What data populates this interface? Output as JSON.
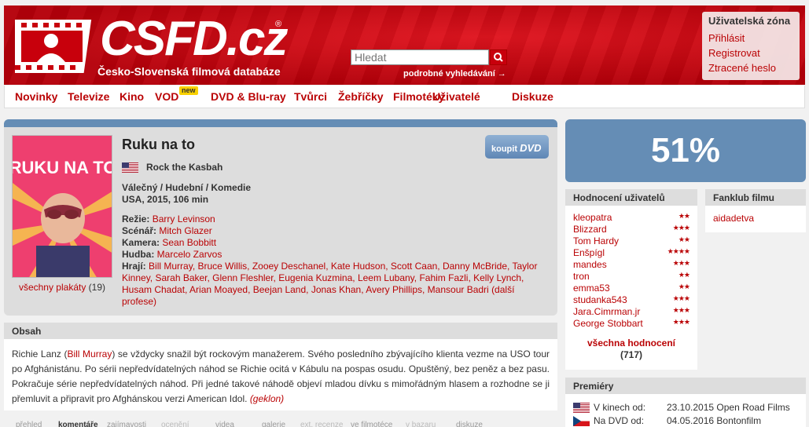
{
  "header": {
    "logo_text": "CSFD.cz",
    "logo_reg": "®",
    "tagline": "Česko-Slovenská filmová databáze",
    "search_placeholder": "Hledat",
    "advanced_search": "podrobné vyhledávání →"
  },
  "user_zone": {
    "title": "Uživatelská zóna",
    "login": "Přihlásit",
    "register": "Registrovat",
    "lost_password": "Ztracené heslo"
  },
  "nav": {
    "items": [
      "Novinky",
      "Televize",
      "Kino",
      "VOD",
      "DVD & Blu-ray",
      "Tvůrci",
      "Žebříčky",
      "Filmotéky",
      "Uživatelé",
      "Diskuze"
    ],
    "new_badge": "new"
  },
  "film": {
    "poster_title": "RUKU NA TO",
    "title": "Ruku na to",
    "original_title": "Rock the Kasbah",
    "genre": "Válečný / Hudební / Komedie",
    "origin": "USA, 2015, 106 min",
    "credits": {
      "director_label": "Režie:",
      "director": "Barry Levinson",
      "writer_label": "Scénář:",
      "writer": "Mitch Glazer",
      "camera_label": "Kamera:",
      "camera": "Sean Bobbitt",
      "music_label": "Hudba:",
      "music": "Marcelo Zarvos",
      "cast_label": "Hrají:",
      "cast": "Bill Murray, Bruce Willis, Zooey Deschanel, Kate Hudson, Scott Caan, Danny McBride, Taylor Kinney, Sarah Baker, Glenn Fleshler, Eugenia Kuzmina, Leem Lubany, Fahim Fazli, Kelly Lynch, Husam Chadat, Arian Moayed, Beejan Land, Jonas Khan, Avery Phillips, Mansour Badri",
      "more": "(další profese)"
    },
    "posters_link": "všechny plakáty",
    "posters_count": " (19)",
    "buy_label": "koupit",
    "buy_dvd": "DVD"
  },
  "obsah": {
    "title": "Obsah",
    "text_before": "Richie Lanz (",
    "actor": "Bill Murray",
    "text_after": ") se vždycky snažil být rockovým manažerem. Svého posledního zbývajícího klienta vezme na USO tour po Afghánistánu. Po sérii nepředvídatelných náhod se Richie ocitá v Kábulu na pospas osudu. Opuštěný, bez peněz a bez pasu. Pokračuje série nepředvídatelných náhod. Při jedné takové náhodě objeví mladou dívku s mimořádným hlasem a rozhodne se ji přemluvit a připravit pro Afghánskou verzi American Idol. ",
    "author": "(geklon)"
  },
  "tabs": [
    "přehled",
    "komentáře",
    "zajímavosti",
    "ocenění",
    "videa",
    "galerie",
    "ext. recenze",
    "ve filmotéce",
    "v bazaru",
    "diskuze"
  ],
  "rating": {
    "percent": "51%",
    "users_title": "Hodnocení uživatelů",
    "users": [
      {
        "name": "kleopatra",
        "stars": "★★"
      },
      {
        "name": "Blizzard",
        "stars": "★★★"
      },
      {
        "name": "Tom Hardy",
        "stars": "★★"
      },
      {
        "name": "Enšpígl",
        "stars": "★★★★"
      },
      {
        "name": "mandes",
        "stars": "★★★"
      },
      {
        "name": "tron",
        "stars": "★★"
      },
      {
        "name": "emma53",
        "stars": "★★"
      },
      {
        "name": "studanka543",
        "stars": "★★★"
      },
      {
        "name": "Jara.Cimrman.jr",
        "stars": "★★★"
      },
      {
        "name": "George Stobbart",
        "stars": "★★★"
      }
    ],
    "all_label": "všechna hodnocení",
    "all_count": "(717)"
  },
  "fanklub": {
    "title": "Fanklub filmu",
    "member": "aidadetva"
  },
  "premiery": {
    "title": "Premiéry",
    "rows": [
      {
        "label": "V kinech od:",
        "value": "23.10.2015 Open Road Films"
      },
      {
        "label": "Na DVD od:",
        "value": "04.05.2016 Bontonfilm"
      }
    ]
  },
  "colors": {
    "brand_red": "#c8000c",
    "link_red": "#ba0305",
    "rating_blue": "#658db5"
  }
}
